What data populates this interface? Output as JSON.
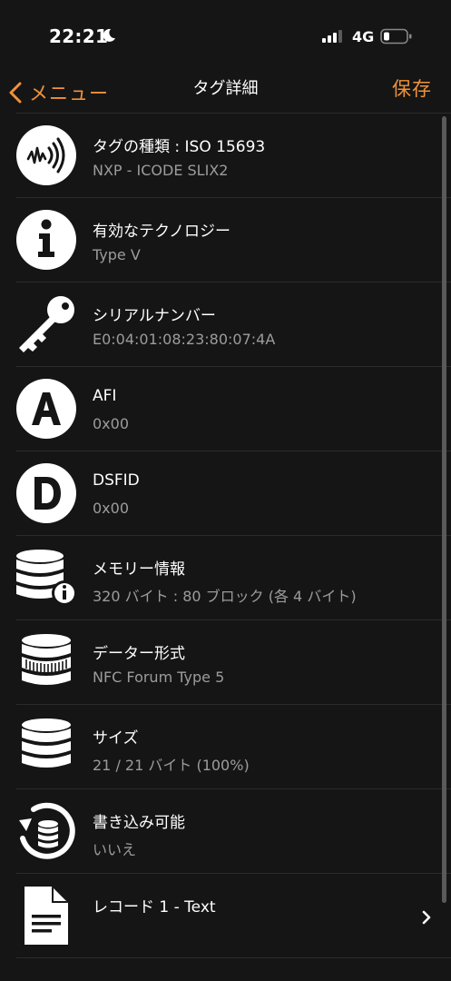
{
  "status": {
    "time": "22:21",
    "network": "4G"
  },
  "nav": {
    "back_label": "メニュー",
    "title": "タグ詳細",
    "save_label": "保存"
  },
  "rows": [
    {
      "icon": "nfc-tag-icon",
      "title": "タグの種類 : ISO 15693",
      "sub": "NXP - ICODE SLIX2"
    },
    {
      "icon": "info-icon",
      "title": "有効なテクノロジー",
      "sub": "Type V"
    },
    {
      "icon": "key-icon",
      "title": "シリアルナンバー",
      "sub": "E0:04:01:08:23:80:07:4A"
    },
    {
      "icon": "letter-a-icon",
      "title": "AFI",
      "sub": "0x00"
    },
    {
      "icon": "letter-d-icon",
      "title": "DSFID",
      "sub": "0x00"
    },
    {
      "icon": "memory-info-icon",
      "title": "メモリー情報",
      "sub": "320 バイト : 80 ブロック (各 4 バイト)"
    },
    {
      "icon": "data-format-icon",
      "title": "データー形式",
      "sub": "NFC Forum Type 5"
    },
    {
      "icon": "database-icon",
      "title": "サイズ",
      "sub": "21 / 21 バイト (100%)"
    },
    {
      "icon": "writable-icon",
      "title": "書き込み可能",
      "sub": "いいえ"
    },
    {
      "icon": "document-icon",
      "title": "レコード 1 - Text"
    }
  ],
  "colors": {
    "accent": "#f0923b",
    "background": "#151515",
    "subtext": "#9c9c9c"
  }
}
